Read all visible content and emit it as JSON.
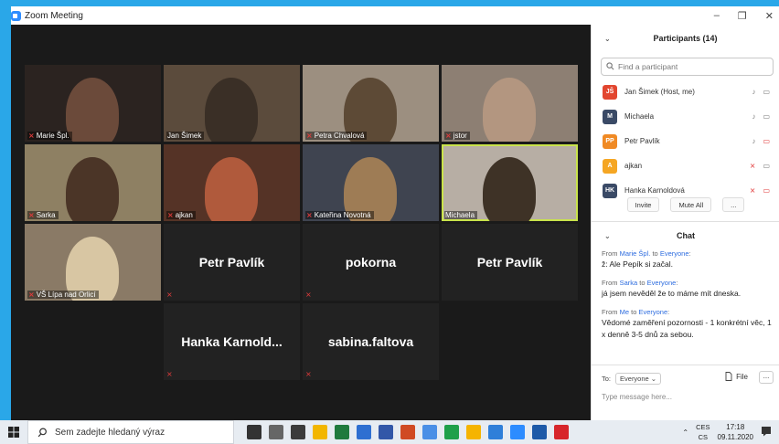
{
  "window": {
    "title": "Zoom Meeting",
    "controls": [
      "–",
      "❐",
      "✕"
    ]
  },
  "gallery": {
    "tiles": [
      {
        "name": "Marie Špl.",
        "muted": true,
        "video": true,
        "bg": "#2b2320",
        "fg": "#6b4a3a"
      },
      {
        "name": "Jan Šimek",
        "muted": false,
        "video": true,
        "bg": "#5b4b3c",
        "fg": "#3a2f26"
      },
      {
        "name": "Petra Chvalová",
        "muted": true,
        "video": true,
        "bg": "#9c8f80",
        "fg": "#5d4a36"
      },
      {
        "name": "jstor",
        "muted": true,
        "video": true,
        "bg": "#8d7f73",
        "fg": "#b39680"
      },
      {
        "name": "Sarka",
        "muted": true,
        "video": true,
        "bg": "#8e8063",
        "fg": "#4b3527"
      },
      {
        "name": "ajkan",
        "muted": true,
        "video": true,
        "bg": "#553326",
        "fg": "#b05a3c"
      },
      {
        "name": "Kateřina Novotná",
        "muted": true,
        "video": true,
        "bg": "#3f4450",
        "fg": "#9e7c55"
      },
      {
        "name": "Michaela",
        "muted": false,
        "video": true,
        "active": true,
        "bg": "#b7aea4",
        "fg": "#3e3226"
      },
      {
        "name": "VŠ Lípa nad Orlicí",
        "muted": true,
        "video": true,
        "bg": "#8a7a66",
        "fg": "#d8c6a3"
      },
      {
        "name": "Petr Pavlík",
        "muted": true,
        "video": false
      },
      {
        "name": "pokorna",
        "muted": true,
        "video": false
      },
      {
        "name": "Petr Pavlík",
        "muted": false,
        "video": false
      },
      {
        "name": "Hanka Karnold...",
        "muted": true,
        "video": false
      },
      {
        "name": "sabina.faltova",
        "muted": true,
        "video": false
      }
    ]
  },
  "participants": {
    "title": "Participants (14)",
    "search_placeholder": "Find a participant",
    "list": [
      {
        "initials": "JŠ",
        "color": "#e2462f",
        "name": "Jan Šimek (Host, me)",
        "mic_muted": false,
        "cam_off": false
      },
      {
        "initials": "M",
        "color": "#3a4a66",
        "name": "Michaela",
        "mic_muted": false,
        "cam_off": false
      },
      {
        "initials": "PP",
        "color": "#f08a24",
        "name": "Petr Pavlík",
        "mic_muted": false,
        "cam_off": true
      },
      {
        "initials": "A",
        "color": "#f5a623",
        "name": "ajkan",
        "mic_muted": true,
        "cam_off": false
      },
      {
        "initials": "HK",
        "color": "#3a4a66",
        "name": "Hanka Karnoldová",
        "mic_muted": true,
        "cam_off": true
      }
    ],
    "invite_label": "Invite",
    "mute_all_label": "Mute All",
    "more_label": "..."
  },
  "chat": {
    "title": "Chat",
    "messages": [
      {
        "from": "Marie Špl.",
        "to": "Everyone",
        "text": "ž: Ale Pepík si začal."
      },
      {
        "from": "Sarka",
        "to": "Everyone",
        "text": "já jsem nevěděl že to máme mít dneska."
      },
      {
        "from": "Me",
        "to": "Everyone",
        "text": "Vědomé zaměření pozornosti - 1 konkrétní věc, 1 x denně 3-5 dnů za sebou."
      }
    ],
    "from_label": "From",
    "to_word": "to",
    "to_label": "To:",
    "recipient": "Everyone",
    "file_label": "File",
    "more_label": "...",
    "input_placeholder": "Type message here..."
  },
  "taskbar": {
    "search_placeholder": "Sem zadejte hledaný výraz",
    "lang_top": "CES",
    "lang_bottom": "CS",
    "time": "17:18",
    "date": "09.11.2020",
    "app_colors": [
      "#333333",
      "#666666",
      "#3b3b3b",
      "#f2b600",
      "#1f7a3d",
      "#2e6fd1",
      "#3257a8",
      "#d04a23",
      "#4a8fe6",
      "#1ea04a",
      "#f5b400",
      "#2f7fd9",
      "#2d8cff",
      "#1e5aa8",
      "#d7262b"
    ]
  }
}
